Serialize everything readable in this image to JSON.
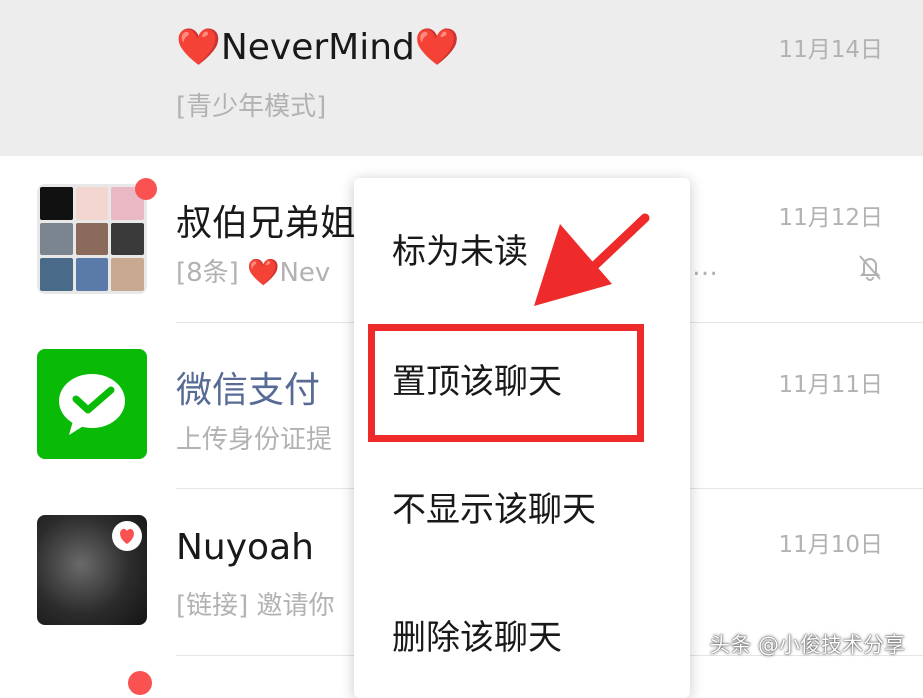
{
  "chats": [
    {
      "name": "❤️NeverMind❤️",
      "preview": "[青少年模式]",
      "time": "11月14日"
    },
    {
      "name": "叔伯兄弟姐",
      "preview": "[8条] ❤️Nev",
      "preview_tail": "…",
      "time": "11月12日",
      "muted": true,
      "unread_dot": true
    },
    {
      "name": "微信支付",
      "preview": "上传身份证提",
      "time": "11月11日",
      "name_color": "#576b95"
    },
    {
      "name": "Nuyoah",
      "preview": "[链接] 邀请你",
      "time": "11月10日"
    }
  ],
  "context_menu": {
    "items": [
      "标为未读",
      "置顶该聊天",
      "不显示该聊天",
      "删除该聊天"
    ],
    "highlighted_index": 1
  },
  "annotation": {
    "color": "#ee2a2a"
  },
  "watermark": "头条 @小俊技术分享",
  "icons": [
    "mute-bell-icon",
    "wechat-pay-icon",
    "heart-icon"
  ],
  "colors": {
    "unread_dot": "#fa5151",
    "wechat_green": "#09bb07",
    "link_blue": "#576b95"
  }
}
